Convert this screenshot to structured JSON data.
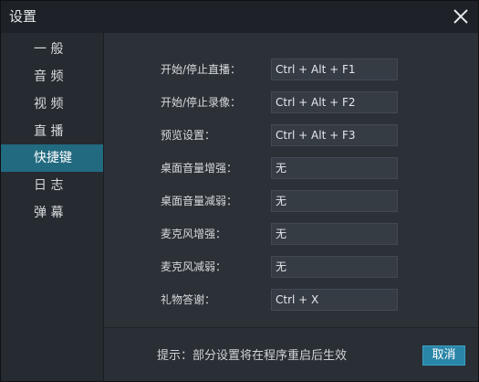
{
  "window": {
    "title": "设置"
  },
  "sidebar": {
    "items": [
      {
        "label": "一 般"
      },
      {
        "label": "音 频"
      },
      {
        "label": "视 频"
      },
      {
        "label": "直 播"
      },
      {
        "label": "快捷键"
      },
      {
        "label": "日 志"
      },
      {
        "label": "弹 幕"
      }
    ],
    "active_index": 4
  },
  "shortcuts": [
    {
      "label": "开始/停止直播：",
      "value": "Ctrl + Alt + F1"
    },
    {
      "label": "开始/停止录像：",
      "value": "Ctrl + Alt + F2"
    },
    {
      "label": "预览设置：",
      "value": "Ctrl + Alt + F3"
    },
    {
      "label": "桌面音量增强：",
      "value": "无"
    },
    {
      "label": "桌面音量减弱：",
      "value": "无"
    },
    {
      "label": "麦克风增强：",
      "value": "无"
    },
    {
      "label": "麦克风减弱：",
      "value": "无"
    },
    {
      "label": "礼物答谢：",
      "value": "Ctrl + X"
    }
  ],
  "footer": {
    "hint": "提示：部分设置将在程序重启后生效",
    "cancel_label": "取消"
  },
  "colors": {
    "accent": "#226a80",
    "button": "#2a86a8",
    "background": "#2a2f36"
  },
  "icons": {
    "close": "close-icon"
  }
}
